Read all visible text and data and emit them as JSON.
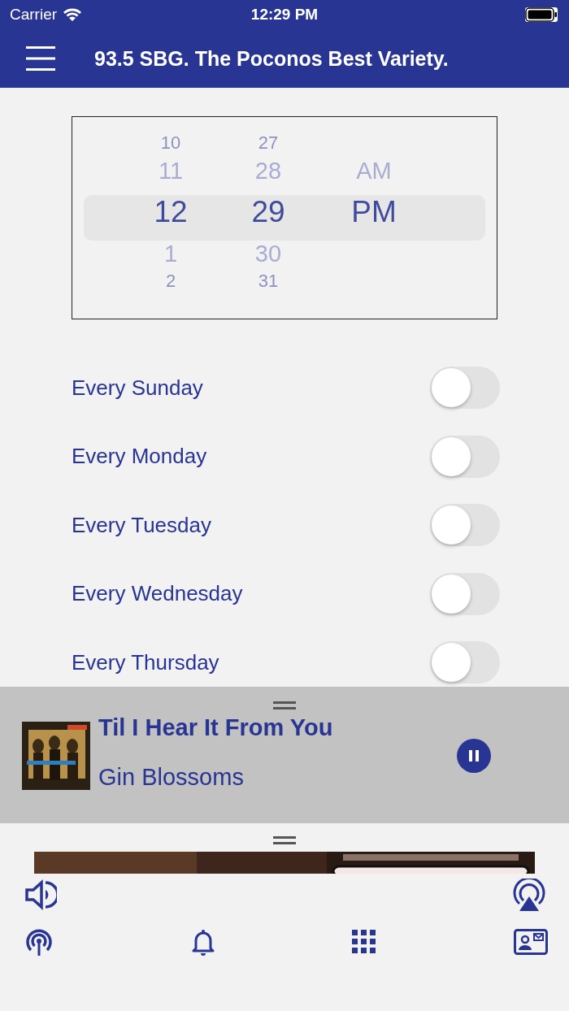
{
  "status_bar": {
    "carrier": "Carrier",
    "time": "12:29 PM"
  },
  "header": {
    "title": "93.5 SBG. The Poconos Best Variety."
  },
  "time_picker": {
    "columns": [
      {
        "items": [
          {
            "label": "10",
            "selected": false
          },
          {
            "label": "11",
            "selected": false
          },
          {
            "label": "12",
            "selected": true
          },
          {
            "label": "1",
            "selected": false
          },
          {
            "label": "2",
            "selected": false
          }
        ]
      },
      {
        "items": [
          {
            "label": "27",
            "selected": false
          },
          {
            "label": "28",
            "selected": false
          },
          {
            "label": "29",
            "selected": true
          },
          {
            "label": "30",
            "selected": false
          },
          {
            "label": "31",
            "selected": false
          }
        ]
      },
      {
        "items": [
          {
            "label": "AM",
            "selected": false
          },
          {
            "label": "PM",
            "selected": true
          }
        ]
      }
    ]
  },
  "repeat_days": [
    {
      "label": "Every Sunday",
      "on": false
    },
    {
      "label": "Every Monday",
      "on": false
    },
    {
      "label": "Every Tuesday",
      "on": false
    },
    {
      "label": "Every Wednesday",
      "on": false
    },
    {
      "label": "Every Thursday",
      "on": false
    }
  ],
  "now_playing": {
    "title": "Til I Hear It From You",
    "artist": "Gin Blossoms",
    "playing": true
  }
}
